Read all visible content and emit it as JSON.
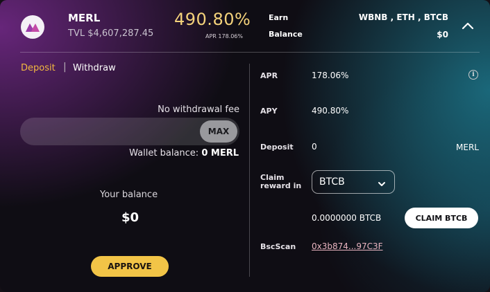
{
  "header": {
    "logo_icon": "merl-logo-icon",
    "name": "MERL",
    "tvl": "TVL $4,607,287.45",
    "apy": "490.80%",
    "apr_small": "APR 178.06%",
    "earn_label": "Earn",
    "earn_value": "WBNB , ETH , BTCB",
    "balance_label": "Balance",
    "balance_value": "$0",
    "collapse_icon": "chevron-up-icon"
  },
  "tabs": {
    "deposit": "Deposit",
    "separator": "|",
    "withdraw": "Withdraw",
    "active": "Deposit"
  },
  "left": {
    "fee_text": "No withdrawal fee",
    "amount_value": "",
    "max_label": "MAX",
    "wallet_label": "Wallet balance:",
    "wallet_value": "0 MERL",
    "your_balance_label": "Your balance",
    "your_balance_value": "$0",
    "approve_label": "APPROVE"
  },
  "right": {
    "apr_label": "APR",
    "apr_value": "178.06%",
    "apy_label": "APY",
    "apy_value": "490.80%",
    "deposit_label": "Deposit",
    "deposit_value": "0",
    "deposit_unit": "MERL",
    "claim_label": "Claim reward in",
    "claim_selected": "BTCB",
    "reward_amount": "0.0000000 BTCB",
    "claim_button": "CLAIM BTCB",
    "bscscan_label": "BscScan",
    "bscscan_link": "0x3b874...97C3F",
    "info_icon": "info-icon"
  },
  "colors": {
    "accent_gold": "#f2c447",
    "tab_active": "#f2b840",
    "link_pink": "#e9b4c0"
  }
}
